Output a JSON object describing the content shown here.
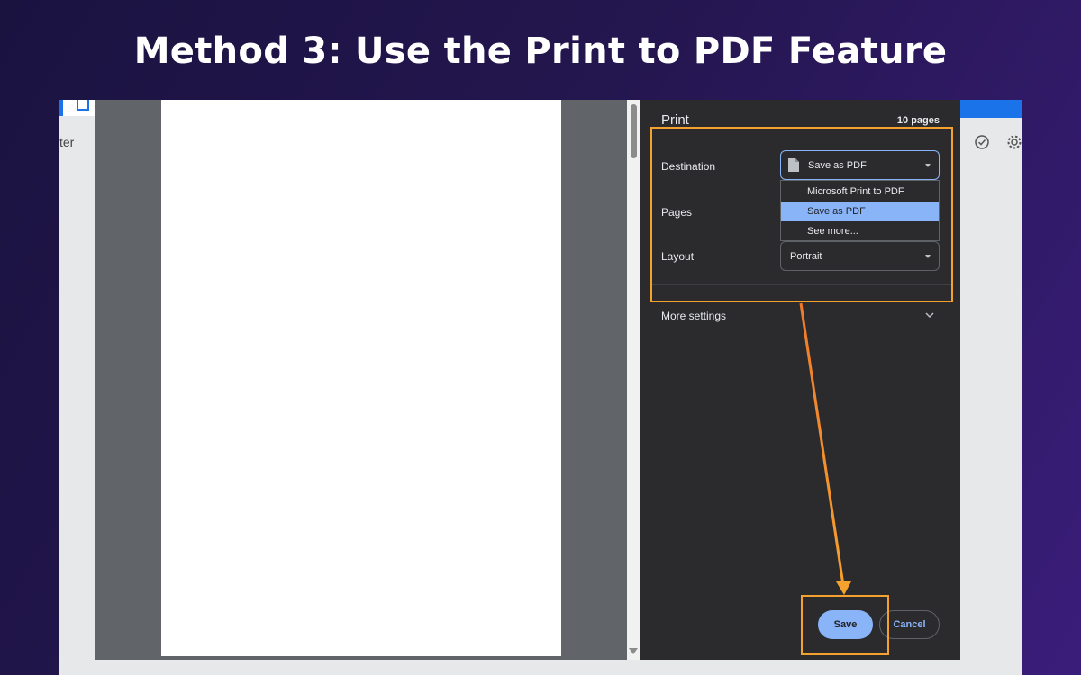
{
  "heading": "Method 3: Use the Print to PDF Feature",
  "background_app": {
    "partial_label": "ter",
    "icons": [
      "check-circle-icon",
      "gear-icon"
    ]
  },
  "print_panel": {
    "title": "Print",
    "page_count": "10 pages",
    "destination": {
      "label": "Destination",
      "value": "Save as PDF",
      "icon": "document-icon",
      "options": [
        "Microsoft Print to PDF",
        "Save as PDF",
        "See more..."
      ],
      "selected_index": 1
    },
    "pages": {
      "label": "Pages"
    },
    "layout": {
      "label": "Layout",
      "value": "Portrait"
    },
    "more_settings": "More settings",
    "save_label": "Save",
    "cancel_label": "Cancel"
  },
  "colors": {
    "accent": "#8ab4f8",
    "highlight": "#f5a12e",
    "panel_bg": "#2b2b2e",
    "title_bg": "#24164f"
  }
}
